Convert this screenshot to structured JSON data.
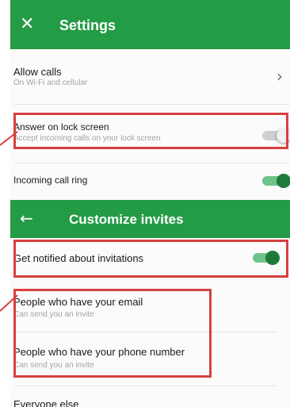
{
  "settings_header": {
    "close_icon": "close-icon",
    "title": "Settings"
  },
  "allow_calls": {
    "title": "Allow calls",
    "subtitle": "On Wi-Fi and cellular",
    "chevron": "›"
  },
  "answer_lock": {
    "title": "Answer on lock screen",
    "subtitle": "Accept incoming calls on your lock screen",
    "enabled": false
  },
  "incoming_ring": {
    "title": "Incoming call ring",
    "enabled": true
  },
  "invites_header": {
    "back_icon": "back-arrow-icon",
    "title": "Customize invites"
  },
  "notified": {
    "title": "Get notified about invitations",
    "enabled": true
  },
  "email": {
    "title": "People who have your email",
    "subtitle": "Can send you an invite"
  },
  "phone": {
    "title": "People who have your phone number",
    "subtitle": "Can send you an invite"
  },
  "everyone": {
    "title": "Everyone else"
  },
  "colors": {
    "toolbar": "#249b45",
    "toggle_on": "#1e7a3b",
    "highlight": "#d7403f"
  }
}
